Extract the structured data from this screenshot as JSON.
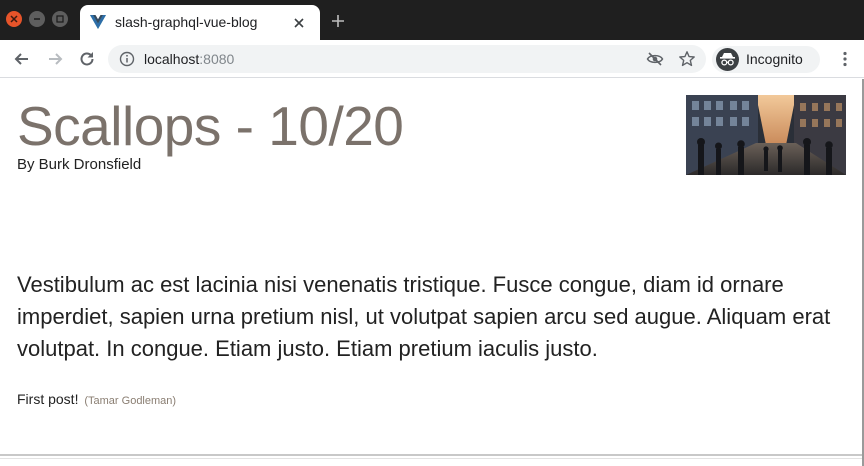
{
  "browser": {
    "tab": {
      "title": "slash-graphql-vue-blog"
    },
    "address_bar": {
      "host": "localhost",
      "port": ":8080"
    },
    "profile": {
      "label": "Incognito"
    },
    "icons": {
      "close_window": "close-icon",
      "minimize_window": "minimize-icon",
      "maximize_window": "maximize-icon",
      "tab_favicon": "vue-logo-icon",
      "tab_close": "close-icon",
      "new_tab": "plus-icon",
      "back": "arrow-left-icon",
      "forward": "arrow-right-icon",
      "reload": "reload-icon",
      "site_info": "info-icon",
      "tracking": "eye-slash-icon",
      "bookmark": "star-icon",
      "incognito": "incognito-icon",
      "menu": "vertical-dots-icon"
    }
  },
  "post": {
    "title": "Scallops - 10/20",
    "author": "By Burk Dronsfield",
    "body": "Vestibulum ac est lacinia nisi venenatis tristique. Fusce congue, diam id ornare imperdiet, sapien urna pretium nisl, ut volutpat sapien arcu sed augue. Aliquam erat volutpat. In congue. Etiam justo. Etiam pretium iaculis justo.",
    "comments": [
      {
        "text": "First post!",
        "author": "(Tamar Godleman)"
      }
    ]
  },
  "colors": {
    "title": "#7b726b",
    "comment_author": "#8a7e72",
    "titlebar": "#1f1f1f",
    "close_button": "#e6542a"
  }
}
